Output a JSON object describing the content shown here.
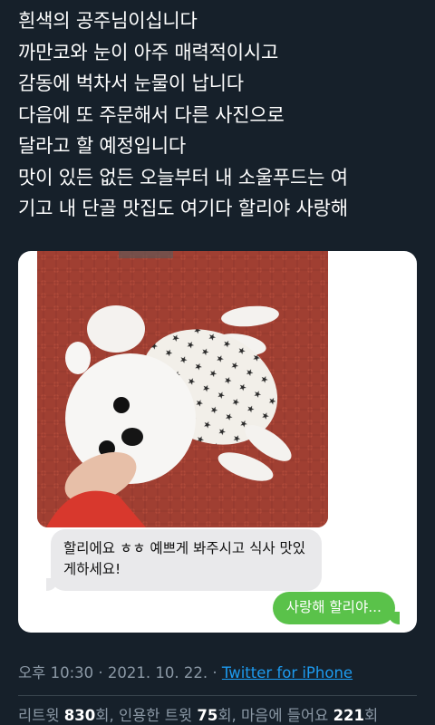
{
  "tweet": {
    "lines": [
      "흰색의 공주님이십니다",
      "까만코와 눈이 아주 매력적이시고",
      "감동에 벅차서 눈물이 납니다",
      "다음에 또 주문해서 다른 사진으로",
      "달라고 할 예정입니다",
      "맛이 있든 없든 오늘부터 내 소울푸드는 여",
      "기고 내 단골 맛집도 여기다 할리야 사랑해"
    ]
  },
  "chat": {
    "received_message": "할리에요 ㅎㅎ 예쁘게 봐주시고 식사 맛있게하세요!",
    "sent_message": "사랑해 할리야..."
  },
  "meta": {
    "time": "오후 10:30",
    "separator": " · ",
    "date": "2021. 10. 22.",
    "source": "Twitter for iPhone"
  },
  "stats": {
    "retweets_label": "리트윗",
    "retweets_count": "830",
    "retweets_unit": "회",
    "quotes_label": "인용한 트윗",
    "quotes_count": "75",
    "quotes_unit": "회",
    "likes_label": "마음에 들어요",
    "likes_count": "221",
    "likes_unit": "회"
  },
  "colors": {
    "background": "#16202a",
    "link": "#1d9bf0",
    "sent_bubble": "#5ac24a",
    "received_bubble": "#e9e9eb"
  }
}
